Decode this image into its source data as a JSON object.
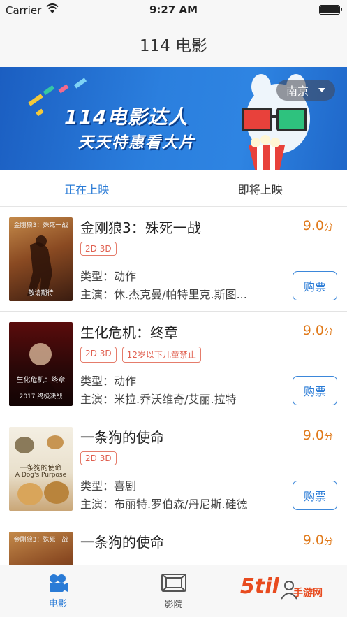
{
  "status": {
    "carrier": "Carrier",
    "time": "9:27 AM"
  },
  "nav": {
    "title": "114 电影"
  },
  "banner": {
    "line1": "114电影达人",
    "line2": "天天特惠看大片",
    "city": "南京"
  },
  "tabs": [
    {
      "label": "正在上映",
      "active": true
    },
    {
      "label": "即将上映",
      "active": false
    }
  ],
  "movies": [
    {
      "title": "金刚狼3：殊死一战",
      "score": "9.0",
      "score_unit": "分",
      "tags": [
        "2D 3D"
      ],
      "type_label": "类型：",
      "type": "动作",
      "cast_label": "主演：",
      "cast": "休.杰克曼/帕特里克.斯图...",
      "buy": "购票",
      "poster_title": "金刚狼3：殊死一战",
      "poster_sub": "敬请期待"
    },
    {
      "title": "生化危机：终章",
      "score": "9.0",
      "score_unit": "分",
      "tags": [
        "2D 3D",
        "12岁以下儿童禁止"
      ],
      "type_label": "类型：",
      "type": "动作",
      "cast_label": "主演：",
      "cast": "米拉.乔沃维奇/艾丽.拉特",
      "buy": "购票",
      "poster_title": "生化危机：终章",
      "poster_sub": "2017 终极决战"
    },
    {
      "title": "一条狗的使命",
      "score": "9.0",
      "score_unit": "分",
      "tags": [
        "2D 3D"
      ],
      "type_label": "类型：",
      "type": "喜剧",
      "cast_label": "主演：",
      "cast": "布丽特.罗伯森/丹尼斯.硅德",
      "buy": "购票",
      "poster_title": "一条狗的使命",
      "poster_sub": "A Dog's Purpose"
    },
    {
      "title": "一条狗的使命",
      "score": "9.0",
      "score_unit": "分",
      "tags": [],
      "type_label": "",
      "type": "",
      "cast_label": "",
      "cast": "",
      "buy": "",
      "poster_title": "金刚狼3：殊死一战",
      "poster_sub": ""
    }
  ],
  "tabbar": [
    {
      "label": "电影",
      "icon": "camera-icon",
      "active": true
    },
    {
      "label": "影院",
      "icon": "cinema-icon",
      "active": false
    },
    {
      "label": "",
      "icon": "person-icon",
      "active": false
    }
  ],
  "watermark": {
    "text": "5til",
    "sub": "手游网"
  },
  "colors": {
    "accent": "#2a7bd6",
    "score": "#e07a1b",
    "tag": "#e06050"
  }
}
